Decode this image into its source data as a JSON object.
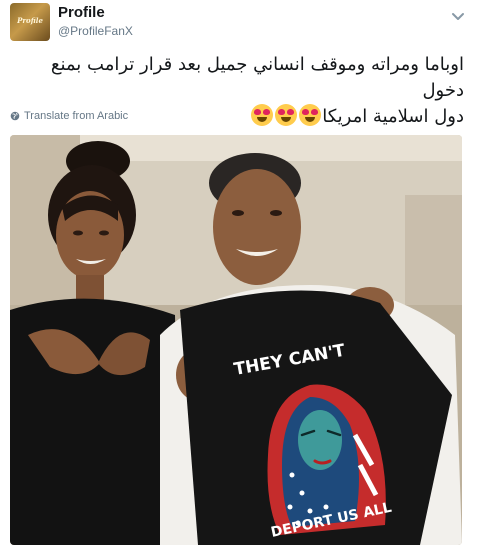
{
  "tweet": {
    "display_name": "Profile",
    "handle": "@ProfileFanX",
    "avatar_label": "Profile",
    "text_line1": "اوباما ومراته وموقف انساني جميل بعد قرار ترامب بمنع دخول",
    "text_line2": "دول اسلامية امريكا",
    "emoji_name": "heart-eyes-emoji",
    "translate_label": "Translate from Arabic"
  },
  "photo": {
    "shirt_text_top": "THEY CAN'T",
    "shirt_text_bottom": "DEPORT US ALL"
  },
  "colors": {
    "text": "#14171a",
    "secondary": "#657786",
    "shirt": "#151515"
  }
}
